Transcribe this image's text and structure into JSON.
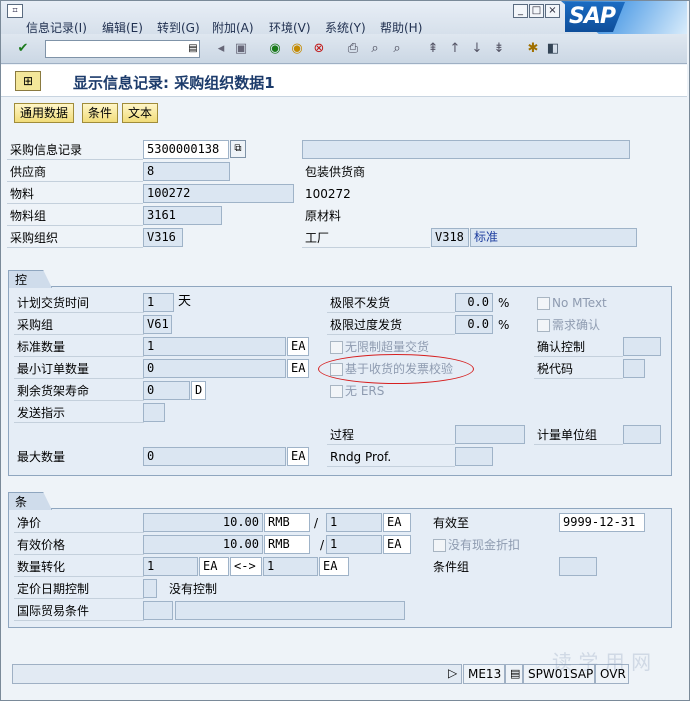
{
  "menu": {
    "items": [
      "信息记录(I)",
      "编辑(E)",
      "转到(G)",
      "附加(A)",
      "环境(V)",
      "系统(Y)",
      "帮助(H)"
    ]
  },
  "window_buttons": [
    "_",
    "□",
    "×"
  ],
  "logo_text": "SAP",
  "title": "显示信息记录: 采购组织数据1",
  "app_buttons": [
    "通用数据",
    "条件",
    "文本"
  ],
  "header": {
    "info_record": {
      "label": "采购信息记录",
      "value": "5300000138"
    },
    "vendor": {
      "label": "供应商",
      "value": "8",
      "desc": "包装供货商"
    },
    "material": {
      "label": "物料",
      "value": "100272",
      "desc": "100272"
    },
    "material_group": {
      "label": "物料组",
      "value": "3161",
      "desc": "原材料"
    },
    "purch_org": {
      "label": "采购组织",
      "value": "V316"
    },
    "plant": {
      "label": "工厂",
      "value": "V318",
      "desc": "标准"
    }
  },
  "control": {
    "title": "控制",
    "planned_delivery": {
      "label": "计划交货时间",
      "value": "1",
      "unit": "天"
    },
    "purch_group": {
      "label": "采购组",
      "value": "V61"
    },
    "std_qty": {
      "label": "标准数量",
      "value": "1",
      "unit": "EA"
    },
    "min_qty": {
      "label": "最小订单数量",
      "value": "0",
      "unit": "EA"
    },
    "shelf_life": {
      "label": "剩余货架寿命",
      "value": "0",
      "unit": "D"
    },
    "ack_req": {
      "label": "发送指示"
    },
    "max_qty": {
      "label": "最大数量",
      "value": "0",
      "unit": "EA"
    },
    "underdelivery": {
      "label": "极限不发货",
      "value": "0.0",
      "unit": "%"
    },
    "overdelivery": {
      "label": "极限过度发货",
      "value": "0.0",
      "unit": "%"
    },
    "unlimited": {
      "label": "无限制超量交货"
    },
    "gr_based_iv": {
      "label": "基于收货的发票校验"
    },
    "no_ers": {
      "label": "无 ERS"
    },
    "procedure": {
      "label": "过程"
    },
    "rndg_prof": {
      "label": "Rndg Prof."
    },
    "no_mtext": {
      "label": "No MText"
    },
    "conf_req": {
      "label": "需求确认"
    },
    "conf_control": {
      "label": "确认控制"
    },
    "tax_code": {
      "label": "税代码"
    },
    "uom_group": {
      "label": "计量单位组"
    }
  },
  "conditions": {
    "title": "条件",
    "net_price": {
      "label": "净价",
      "value": "10.00",
      "currency": "RMB",
      "per": "1",
      "unit": "EA"
    },
    "eff_price": {
      "label": "有效价格",
      "value": "10.00",
      "currency": "RMB",
      "per": "1",
      "unit": "EA"
    },
    "valid_to": {
      "label": "有效至",
      "value": "9999-12-31"
    },
    "no_cash_disc": {
      "label": "没有现金折扣"
    },
    "qty_conv": {
      "label": "数量转化",
      "from": "1",
      "from_unit": "EA",
      "arrow": "<->",
      "to": "1",
      "to_unit": "EA"
    },
    "cond_group": {
      "label": "条件组"
    },
    "pricing_date": {
      "label": "定价日期控制",
      "desc": "没有控制"
    },
    "incoterms": {
      "label": "国际贸易条件"
    }
  },
  "status": {
    "transaction": "ME13",
    "system": "SPW01SAP",
    "mode": "OVR"
  },
  "watermark": "读 学 用 网"
}
